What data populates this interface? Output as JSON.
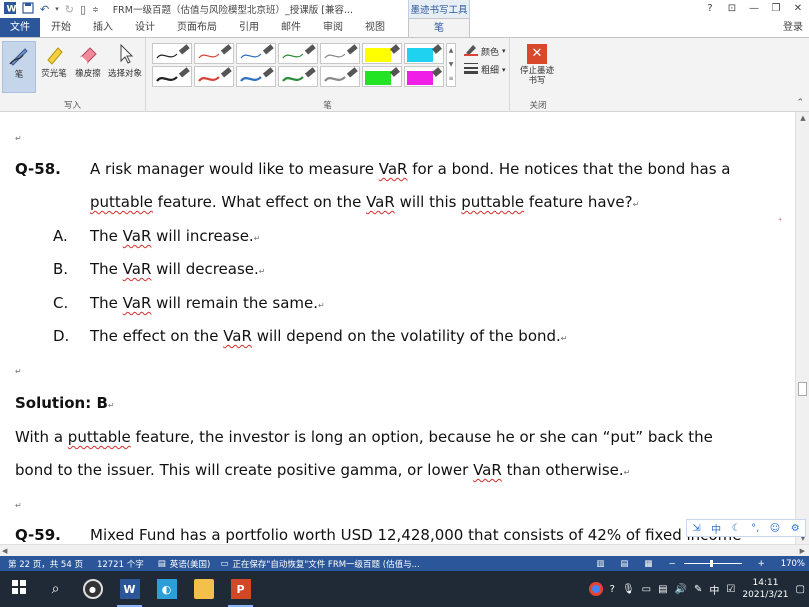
{
  "titlebar": {
    "title": "FRM一级百题（估值与风险模型北京班）_授课版 [兼容...",
    "context_tab": "墨迹书写工具",
    "help": "?",
    "minimize": "—",
    "restore": "❐",
    "close": "✕",
    "ribbon_display": "⊡"
  },
  "tabs": {
    "file": "文件",
    "items": [
      "开始",
      "插入",
      "设计",
      "页面布局",
      "引用",
      "邮件",
      "审阅",
      "视图"
    ],
    "pen": "笔",
    "login": "登录"
  },
  "ribbon": {
    "write_group": "写入",
    "pen_group": "笔",
    "close_group": "关闭",
    "tools": {
      "pen": "笔",
      "highlighter": "荧光笔",
      "eraser": "橡皮擦",
      "select": "选择对象"
    },
    "color": "颜色",
    "thickness": "粗细",
    "stop": "停止墨迹书写",
    "colors": {
      "black": "#222222",
      "red": "#d9443a",
      "blue": "#2f6fc0",
      "green": "#2e8b3a",
      "yellow": "#ffff00",
      "cyan": "#1fd3f0",
      "lime": "#22e422",
      "magenta": "#f01fe8"
    }
  },
  "document": {
    "q58_num": "Q-58.",
    "q58_line1": {
      "a": "A risk manager would like to measure ",
      "var": "VaR",
      "b": " for a bond. He notices that the bond has a"
    },
    "q58_line2": {
      "puttable1": "puttable",
      "a": " feature. What effect on the ",
      "var": "VaR",
      "b": " will this ",
      "puttable2": "puttable",
      "c": " feature have?"
    },
    "options": [
      {
        "letter": "A.",
        "pre": "The ",
        "var": "VaR",
        "post": " will increase."
      },
      {
        "letter": "B.",
        "pre": "The ",
        "var": "VaR",
        "post": " will decrease."
      },
      {
        "letter": "C.",
        "pre": "The ",
        "var": "VaR",
        "post": " will remain the same."
      },
      {
        "letter": "D.",
        "pre": "The effect on the ",
        "var": "VaR",
        "post": " will depend on the volatility of the bond."
      }
    ],
    "solution": "Solution: B",
    "sol_line1": {
      "a": "With a ",
      "puttable": "puttable",
      "b": " feature, the investor is long an option, because he or she can “put” back the"
    },
    "sol_line2": {
      "a": "bond to the issuer. This will create positive gamma, or lower ",
      "var": "VaR",
      "b": " than otherwise."
    },
    "q59_num": "Q-59.",
    "q59_text": "Mixed Fund has a portfolio worth USD 12,428,000 that consists of 42% of fixed income"
  },
  "statusbar": {
    "page": "第 22 页，共 54 页",
    "words": "12721 个字",
    "lang": "英语(美国)",
    "saving": "正在保存\"自动恢复\"文件 FRM一级百题 (估值与...",
    "zoom": "170%"
  },
  "ime": {
    "mode": "中"
  },
  "taskbar": {
    "time": "14:11",
    "date": "2021/3/21",
    "lang": "中",
    "word_app": "W",
    "ppt_app": "P"
  }
}
